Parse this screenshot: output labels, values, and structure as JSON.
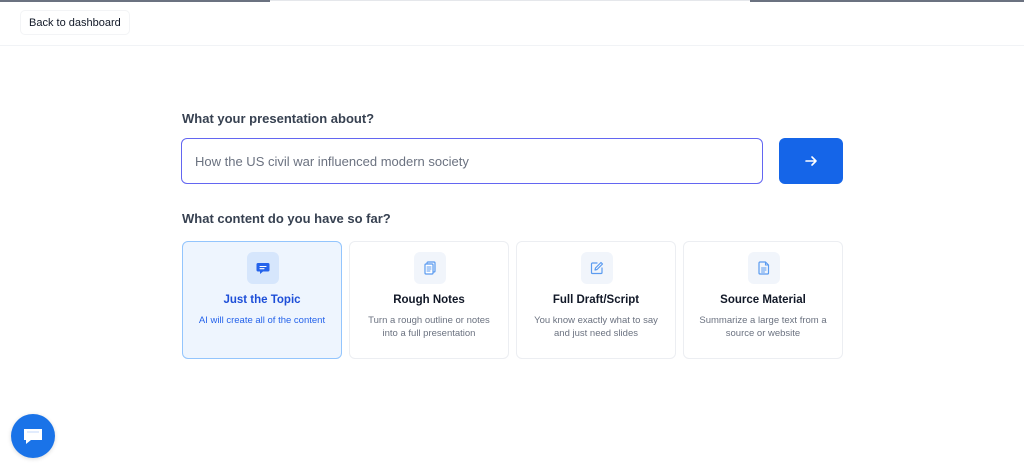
{
  "header": {
    "back_label": "Back to dashboard"
  },
  "prompt": {
    "question": "What your presentation about?",
    "input_value": "How the US civil war influenced modern society",
    "submit_icon": "arrow-right-icon"
  },
  "content": {
    "question": "What content do you have so far?",
    "options": [
      {
        "title": "Just the Topic",
        "desc": "AI will create all of the content",
        "icon": "message-icon",
        "selected": true
      },
      {
        "title": "Rough Notes",
        "desc": "Turn a rough outline or notes into a full presentation",
        "icon": "notes-icon",
        "selected": false
      },
      {
        "title": "Full Draft/Script",
        "desc": "You know exactly what to say and just need slides",
        "icon": "edit-icon",
        "selected": false
      },
      {
        "title": "Source Material",
        "desc": "Summarize a large text from a source or website",
        "icon": "document-icon",
        "selected": false
      }
    ]
  },
  "colors": {
    "accent": "#1565e8",
    "selected_bg": "#eef5fe",
    "input_border": "#6366f1"
  },
  "chat": {
    "icon": "chat-icon"
  }
}
